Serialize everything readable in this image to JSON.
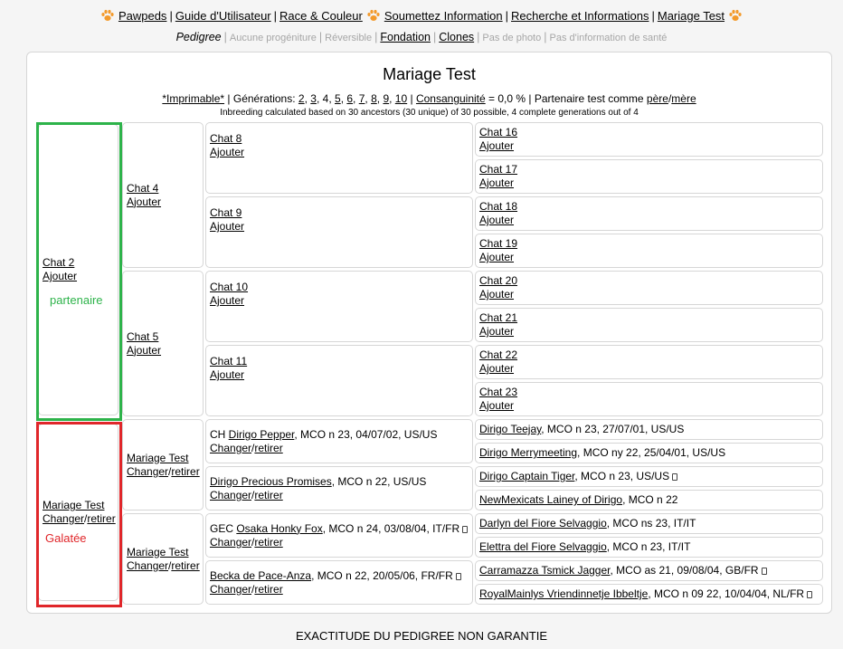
{
  "nav": {
    "items": [
      "Pawpeds",
      "Guide d'Utilisateur",
      "Race & Couleur",
      "Soumettez Information",
      "Recherche et Informations",
      "Mariage Test"
    ],
    "sub": {
      "current": "Pedigree",
      "no_progeny": "Aucune progéniture",
      "reversible": "Réversible",
      "foundation": "Fondation",
      "clones": "Clones",
      "no_photo": "Pas de photo",
      "no_health": "Pas d'information de santé"
    }
  },
  "title": "Mariage Test",
  "options": {
    "printable": "*Imprimable*",
    "generations_label": "Générations:",
    "generations": [
      "2",
      "3",
      "4",
      "5",
      "6",
      "7",
      "8",
      "9",
      "10"
    ],
    "inbreeding_label": "Consanguinité",
    "inbreeding_value": "= 0,0 %",
    "partner_label": "Partenaire test comme",
    "father": "père",
    "mother": "mère"
  },
  "inbreeding_note": "Inbreeding calculated based on 30 ancestors (30 unique) of 30 possible, 4 complete generations out of 4",
  "actions": {
    "add": "Ajouter",
    "change": "Changer",
    "remove": "retirer"
  },
  "labels": {
    "partner": "partenaire",
    "galatee": "Galatée"
  },
  "pedigree": {
    "g1": [
      {
        "name": "Chat 2"
      },
      {
        "name": "Mariage Test"
      }
    ],
    "g2": [
      {
        "name": "Chat 4"
      },
      {
        "name": "Chat 5"
      },
      {
        "name": "Mariage Test"
      },
      {
        "name": "Mariage Test"
      }
    ],
    "g3": [
      {
        "prefix": "",
        "name": "Chat 8",
        "info": ""
      },
      {
        "prefix": "",
        "name": "Chat 9",
        "info": ""
      },
      {
        "prefix": "",
        "name": "Chat 10",
        "info": ""
      },
      {
        "prefix": "",
        "name": "Chat 11",
        "info": ""
      },
      {
        "prefix": "CH ",
        "name": "Dirigo Pepper",
        "info": ", MCO n 23, 04/07/02, US/US"
      },
      {
        "prefix": "",
        "name": "Dirigo Precious Promises",
        "info": ", MCO n 22, US/US"
      },
      {
        "prefix": "GEC ",
        "name": "Osaka Honky Fox",
        "info": ", MCO n 24, 03/08/04, IT/FR"
      },
      {
        "prefix": "",
        "name": "Becka de Pace-Anza",
        "info": ", MCO n 22, 20/05/06, FR/FR"
      }
    ],
    "g4": [
      {
        "name": "Chat 16",
        "info": ""
      },
      {
        "name": "Chat 17",
        "info": ""
      },
      {
        "name": "Chat 18",
        "info": ""
      },
      {
        "name": "Chat 19",
        "info": ""
      },
      {
        "name": "Chat 20",
        "info": ""
      },
      {
        "name": "Chat 21",
        "info": ""
      },
      {
        "name": "Chat 22",
        "info": ""
      },
      {
        "name": "Chat 23",
        "info": ""
      },
      {
        "name": "Dirigo Teejay",
        "info": ", MCO n 23, 27/07/01, US/US"
      },
      {
        "name": "Dirigo Merrymeeting",
        "info": ", MCO ny 22, 25/04/01, US/US"
      },
      {
        "name": "Dirigo Captain Tiger",
        "info": ", MCO n 23, US/US"
      },
      {
        "name": "NewMexicats Lainey of Dirigo",
        "info": ", MCO n 22"
      },
      {
        "name": "Darlyn del Fiore Selvaggio",
        "info": ", MCO ns 23, IT/IT"
      },
      {
        "name": "Elettra del Fiore Selvaggio",
        "info": ", MCO n 23, IT/IT"
      },
      {
        "name": "Carramazza Tsmick Jagger",
        "info": ", MCO as 21, 09/08/04, GB/FR"
      },
      {
        "name": "RoyalMainlys Vriendinnetje Ibbeltje",
        "info": ", MCO n 09 22, 10/04/04, NL/FR"
      }
    ]
  },
  "footer": "EXACTITUDE DU PEDIGREE NON GARANTIE"
}
